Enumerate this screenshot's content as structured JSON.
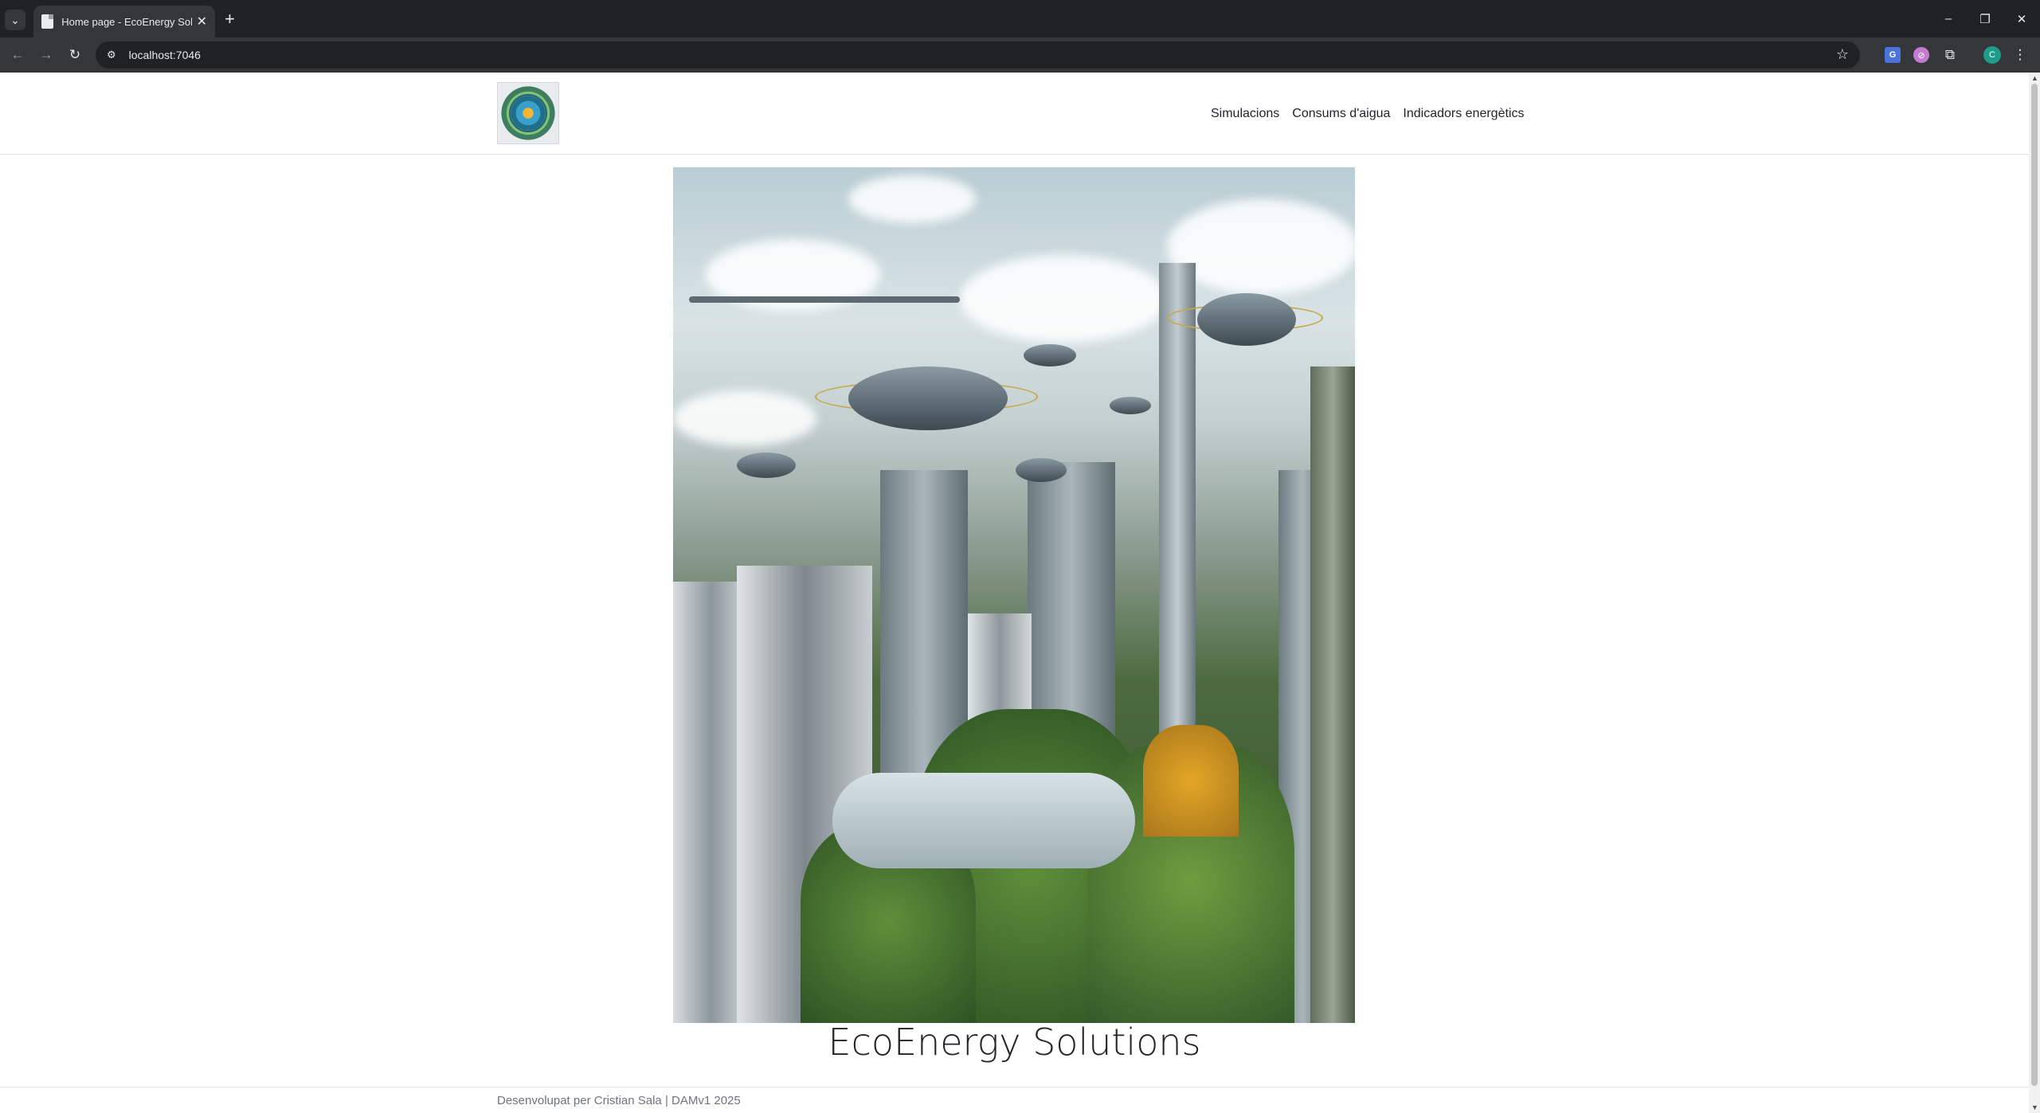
{
  "browser": {
    "tab_title": "Home page - EcoEnergy Solutions",
    "url": "localhost:7046",
    "icons": {
      "tab_search": "chevron-down-icon",
      "new_tab": "plus-icon",
      "back": "arrow-left-icon",
      "forward": "arrow-right-icon",
      "reload": "reload-icon",
      "site_info": "tune-icon",
      "bookmark": "star-icon"
    }
  },
  "header": {
    "logo_alt": "EcoEnergy logo",
    "nav": [
      {
        "label": "Simulacions"
      },
      {
        "label": "Consums d'aigua"
      },
      {
        "label": "Indicadors energètics"
      }
    ]
  },
  "main": {
    "hero_image": "futuristic-green-city-illustration",
    "title": "EcoEnergy Solutions"
  },
  "footer": {
    "text": "Desenvolupat per Cristian Sala | DAMv1 2025"
  },
  "colors": {
    "chrome_dark": "#202124",
    "chrome_toolbar": "#35363a",
    "text": "#212529",
    "muted": "#6c757d"
  }
}
